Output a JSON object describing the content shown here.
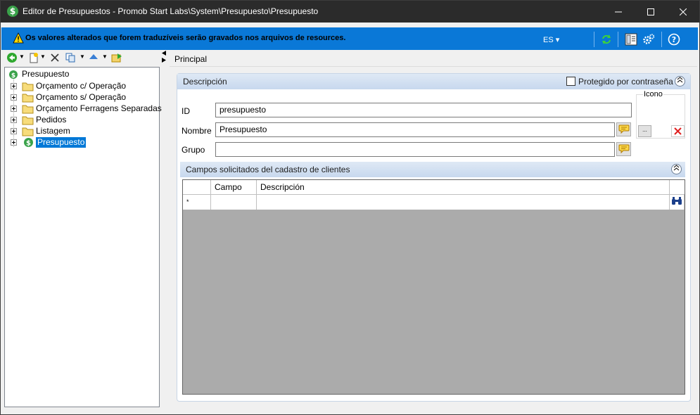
{
  "window": {
    "title": "Editor de Presupuestos - Promob Start Labs\\System\\Presupuesto\\Presupuesto",
    "controls": {
      "minimize": "minimize-icon",
      "maximize": "maximize-icon",
      "close": "close-icon"
    }
  },
  "infobar": {
    "message": "Os valores alterados que forem traduzíveis serão gravados nos arquivos de resources.",
    "language": "ES ▾",
    "color": "#0a78d7"
  },
  "tree": {
    "root": "Presupuesto",
    "items": [
      {
        "label": "Orçamento c/ Operação",
        "icon": "folder-icon"
      },
      {
        "label": "Orçamento s/ Operação",
        "icon": "folder-icon"
      },
      {
        "label": "Orçamento Ferragens Separadas",
        "icon": "folder-icon"
      },
      {
        "label": "Pedidos",
        "icon": "folder-icon"
      },
      {
        "label": "Listagem",
        "icon": "folder-icon"
      },
      {
        "label": "Presupuesto",
        "icon": "dollar-icon",
        "selected": true
      }
    ]
  },
  "tabs": {
    "principal": "Principal"
  },
  "descripcion": {
    "header": "Descripción",
    "protect_label": "Protegido por contraseña",
    "protected": false,
    "id_label": "ID",
    "id_value": "presupuesto",
    "nombre_label": "Nombre",
    "nombre_value": "Presupuesto",
    "grupo_label": "Grupo",
    "grupo_value": "",
    "icono_label": "Icono",
    "browse_label": "..."
  },
  "campos": {
    "header": "Campos solicitados del cadastro de clientes",
    "columns": [
      "",
      "Campo",
      "Descripción"
    ],
    "new_row_marker": "*"
  }
}
